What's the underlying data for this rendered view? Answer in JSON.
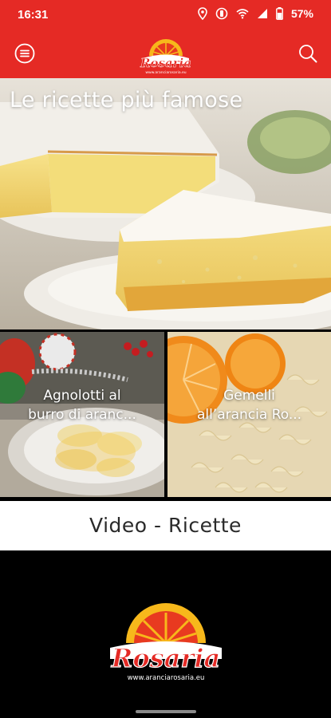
{
  "status_bar": {
    "time": "16:31",
    "battery": "57%",
    "icons": [
      "location-icon",
      "vibrate-icon",
      "wifi-icon",
      "signal-icon",
      "battery-icon"
    ]
  },
  "app_bar": {
    "logo_text": "Rosaria",
    "logo_url": "www.aranciarosaria.eu",
    "menu_icon": "menu-icon",
    "search_icon": "search-icon",
    "brand_color": "#e52a25"
  },
  "hero": {
    "title": "Le ricette più famose"
  },
  "tiles": [
    {
      "line1": "Agnolotti al",
      "line2": "burro di aranc..."
    },
    {
      "line1": "Gemelli",
      "line2": "all’arancia Ro..."
    }
  ],
  "video_band": {
    "label": "Video - Ricette"
  },
  "footer": {
    "logo_text": "Rosaria",
    "logo_url": "www.aranciarosaria.eu"
  }
}
